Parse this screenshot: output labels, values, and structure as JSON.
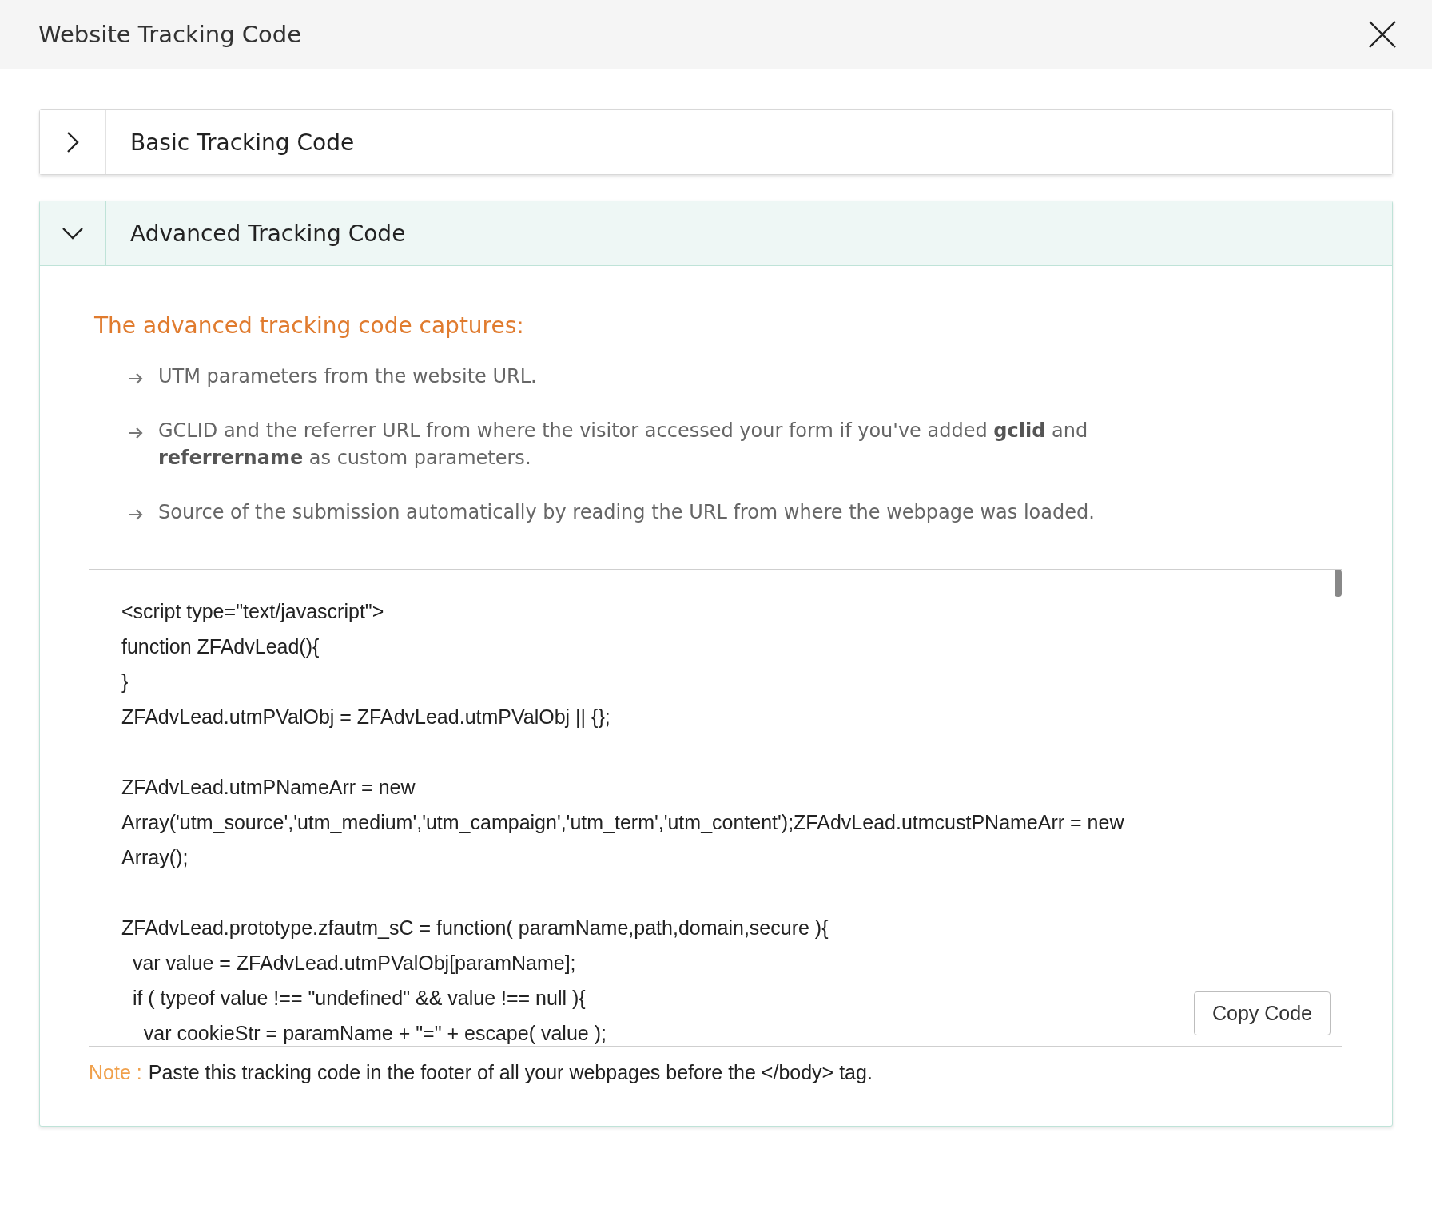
{
  "dialog": {
    "title": "Website Tracking Code"
  },
  "sections": [
    {
      "title": "Basic Tracking Code",
      "expanded": false
    },
    {
      "title": "Advanced Tracking Code",
      "expanded": true,
      "heading": "The advanced tracking code captures:",
      "bullets": [
        "UTM parameters from the website URL.",
        "GCLID and the referrer URL from where the visitor accessed your form if you've added **gclid** and **referrername** as custom parameters.",
        "Source of the submission automatically by reading the URL from where the webpage was loaded."
      ],
      "code_blocks": [
        [
          "<script type=\"text/javascript\">",
          "function ZFAdvLead(){",
          "}",
          "ZFAdvLead.utmPValObj = ZFAdvLead.utmPValObj || {};"
        ],
        [
          "ZFAdvLead.utmPNameArr = new",
          "Array('utm_source','utm_medium','utm_campaign','utm_term','utm_content');ZFAdvLead.utmcustPNameArr = new",
          "Array();"
        ],
        [
          "ZFAdvLead.prototype.zfautm_sC = function( paramName,path,domain,secure ){",
          "  var value = ZFAdvLead.utmPValObj[paramName];",
          "  if ( typeof value !== \"undefined\" && value !== null ){",
          "    var cookieStr = paramName + \"=\" + escape( value );"
        ]
      ],
      "copy_button": "Copy Code",
      "note_label": "Note :",
      "note": "Paste this tracking code in the footer of all your webpages before the </body> tag."
    }
  ]
}
